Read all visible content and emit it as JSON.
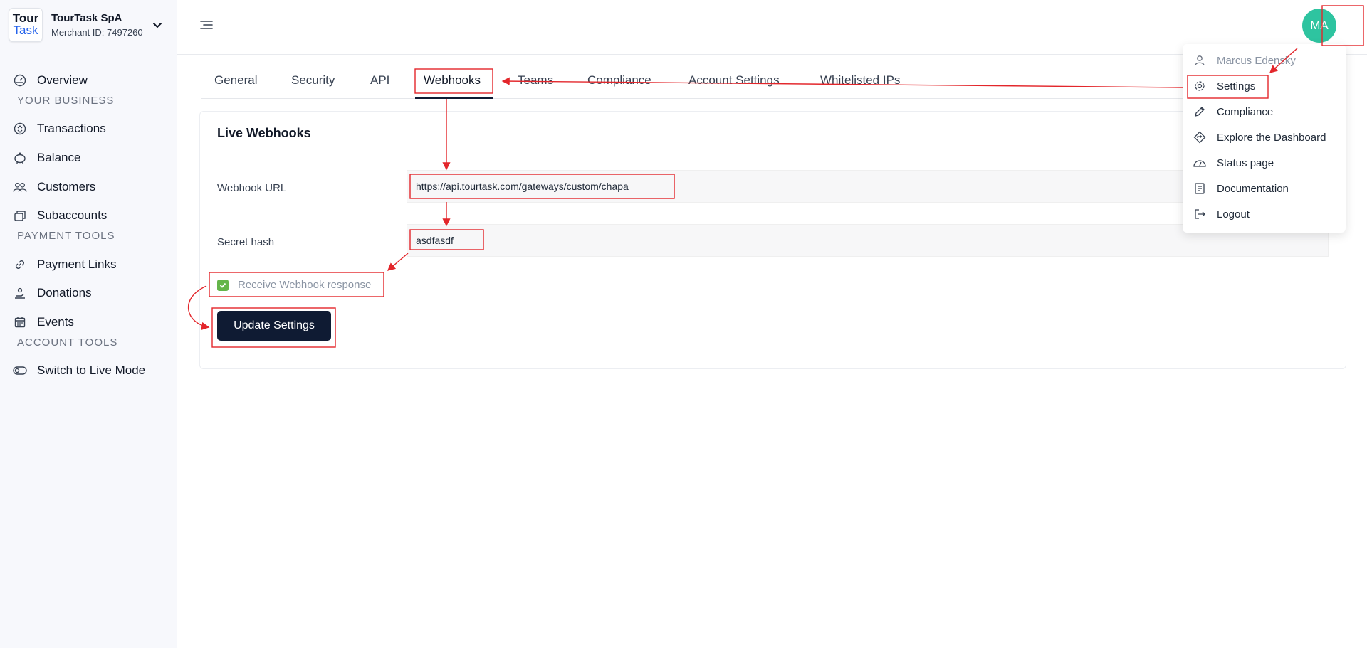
{
  "brand": {
    "logo_line1": "Tour",
    "logo_line2": "Task",
    "name": "TourTask SpA",
    "merchant_id": "Merchant ID: 7497260"
  },
  "sidebar": {
    "items": [
      {
        "label": "Overview",
        "icon": "dashboard-gauge-icon"
      },
      {
        "label": "Transactions",
        "icon": "coin-circle-icon"
      },
      {
        "label": "Balance",
        "icon": "piggy-bank-icon"
      },
      {
        "label": "Customers",
        "icon": "users-group-icon"
      },
      {
        "label": "Subaccounts",
        "icon": "stacked-cards-icon"
      },
      {
        "label": "Payment Links",
        "icon": "link-icon"
      },
      {
        "label": "Donations",
        "icon": "donation-hand-icon"
      },
      {
        "label": "Events",
        "icon": "calendar-icon"
      },
      {
        "label": "Switch to Live Mode",
        "icon": "toggle-icon"
      }
    ],
    "sections": [
      "YOUR BUSINESS",
      "PAYMENT TOOLS",
      "ACCOUNT TOOLS"
    ]
  },
  "header": {
    "avatar_initials": "MA"
  },
  "tabs": [
    {
      "label": "General"
    },
    {
      "label": "Security"
    },
    {
      "label": "API"
    },
    {
      "label": "Webhooks",
      "active": true
    },
    {
      "label": "Teams"
    },
    {
      "label": "Compliance"
    },
    {
      "label": "Account Settings"
    },
    {
      "label": "Whitelisted IPs"
    }
  ],
  "webhooks": {
    "title": "Live Webhooks",
    "url_label": "Webhook URL",
    "url_value": "https://api.tourtask.com/gateways/custom/chapa",
    "secret_label": "Secret hash",
    "secret_value": "asdfasdf",
    "receive_response_label": "Receive Webhook response",
    "receive_response_checked": true,
    "update_button": "Update Settings"
  },
  "user_menu": {
    "items": [
      {
        "label": "Marcus Edensky",
        "icon": "user-icon"
      },
      {
        "label": "Settings",
        "icon": "gear-icon"
      },
      {
        "label": "Compliance",
        "icon": "pencil-icon"
      },
      {
        "label": "Explore the Dashboard",
        "icon": "signpost-diamond-icon"
      },
      {
        "label": "Status page",
        "icon": "status-gauge-icon"
      },
      {
        "label": "Documentation",
        "icon": "document-icon"
      },
      {
        "label": "Logout",
        "icon": "logout-icon"
      }
    ]
  },
  "colors": {
    "accent_dark": "#0f1b33",
    "avatar_bg": "#2ec4a0",
    "checkbox_green": "#64b54a",
    "annotation_red": "#e3262b"
  }
}
